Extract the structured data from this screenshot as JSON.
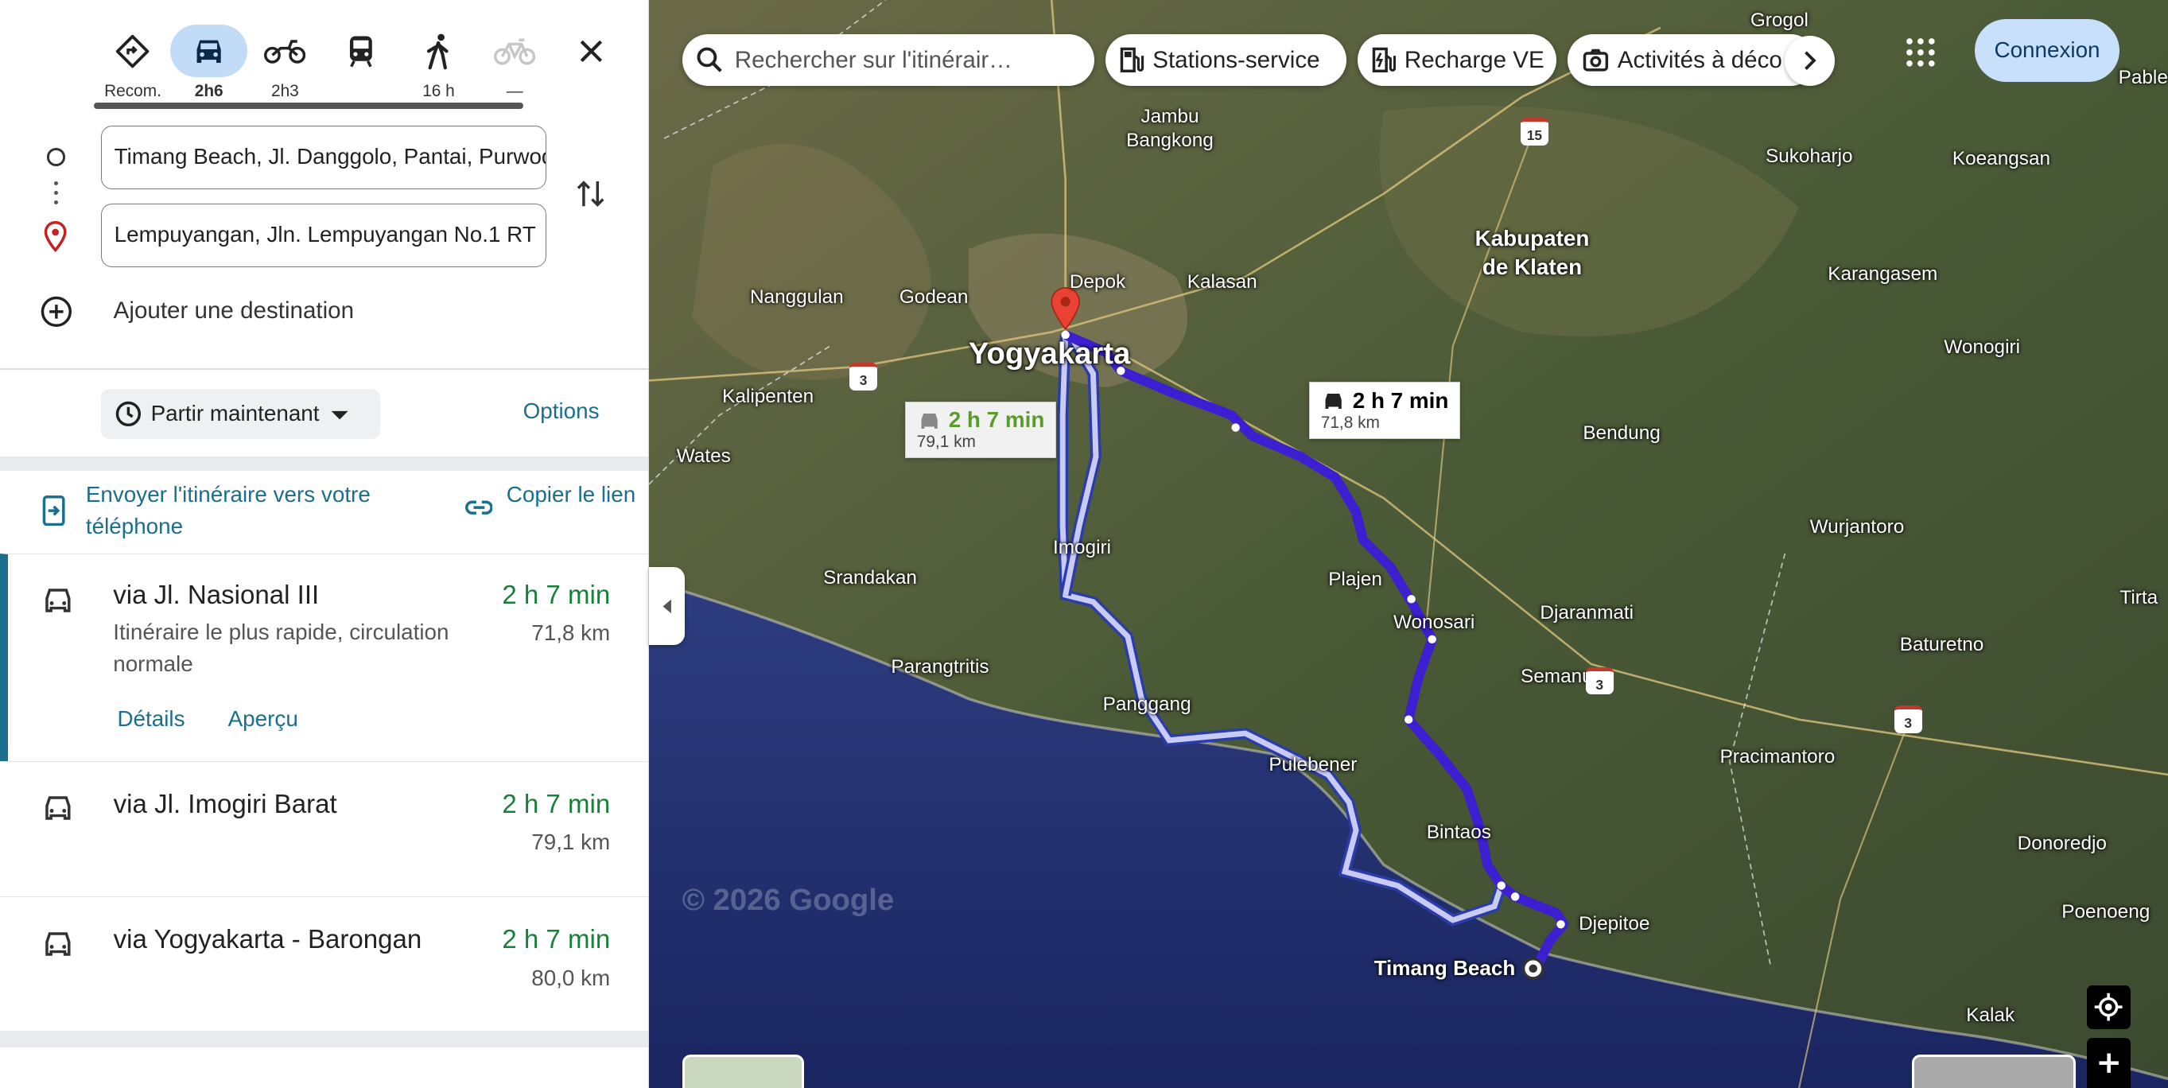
{
  "modes": [
    {
      "name": "recommended",
      "label": "Recom.",
      "icon": "diamond-turn-icon"
    },
    {
      "name": "car",
      "label": "2h6",
      "icon": "car-icon"
    },
    {
      "name": "motorbike",
      "label": "2h3",
      "icon": "motorbike-icon"
    },
    {
      "name": "transit",
      "label": "",
      "icon": "train-icon"
    },
    {
      "name": "walk",
      "label": "16 h",
      "icon": "walk-icon"
    },
    {
      "name": "bike",
      "label": "—",
      "icon": "bike-icon"
    }
  ],
  "waypoints": {
    "origin": "Timang Beach, Jl. Danggolo, Pantai, Purwodadi",
    "destination": "Lempuyangan, Jln. Lempuyangan No.1 RT"
  },
  "add_destination": "Ajouter une destination",
  "depart_label": "Partir maintenant",
  "options_label": "Options",
  "send_to_phone": "Envoyer l'itinéraire vers votre téléphone",
  "copy_link": "Copier le lien",
  "routes": [
    {
      "name": "via Jl. Nasional III",
      "time": "2 h 7 min",
      "distance": "71,8 km",
      "description": "Itinéraire le plus rapide, circulation normale",
      "details": "Détails",
      "preview": "Aperçu"
    },
    {
      "name": "via Jl. Imogiri Barat",
      "time": "2 h 7 min",
      "distance": "79,1 km"
    },
    {
      "name": "via Yogyakarta - Barongan",
      "time": "2 h 7 min",
      "distance": "80,0 km"
    }
  ],
  "map": {
    "search_placeholder": "Rechercher sur l'itinérair…",
    "chips": [
      "Stations-service",
      "Recharge VE",
      "Activités à déco"
    ],
    "login": "Connexion",
    "copyright": "© 2026 Google",
    "bubble_main": {
      "time": "2 h 7 min",
      "distance": "71,8 km"
    },
    "bubble_alt": {
      "time": "2 h 7 min",
      "distance": "79,1 km"
    },
    "labels": {
      "grogol": "Grogol",
      "jambu": "Jambu\nBangkong",
      "sukoharjo": "Sukoharjo",
      "koeangsan": "Koeangsan",
      "pable": "Pable",
      "klaten": "Kabupaten\nde Klaten",
      "karangasem": "Karangasem",
      "depok": "Depok",
      "kalasan": "Kalasan",
      "nanggulan": "Nanggulan",
      "godean": "Godean",
      "yogyakarta": "Yogyakarta",
      "wonogiri": "Wonogiri",
      "kalipenten": "Kalipenten",
      "bendung": "Bendung",
      "wates": "Wates",
      "wurjantoro": "Wurjantoro",
      "imogiri": "Imogiri",
      "srandakan": "Srandakan",
      "plajen": "Plajen",
      "tirta": "Tirta",
      "djaranmati": "Djaranmati",
      "wonosari": "Wonosari",
      "parangtritis": "Parangtritis",
      "baturetno": "Baturetno",
      "semanu": "Semanu",
      "panggang": "Panggang",
      "pulebener": "Pulebener",
      "pracimantoro": "Pracimantoro",
      "bintaos": "Bintaos",
      "donoredjo": "Donoredjo",
      "poenoeng": "Poenoeng",
      "djepitoe": "Djepitoe",
      "timang": "Timang Beach",
      "kalak": "Kalak"
    },
    "shields": {
      "s15": "15",
      "s3a": "3",
      "s3b": "3",
      "s3c": "3"
    }
  }
}
